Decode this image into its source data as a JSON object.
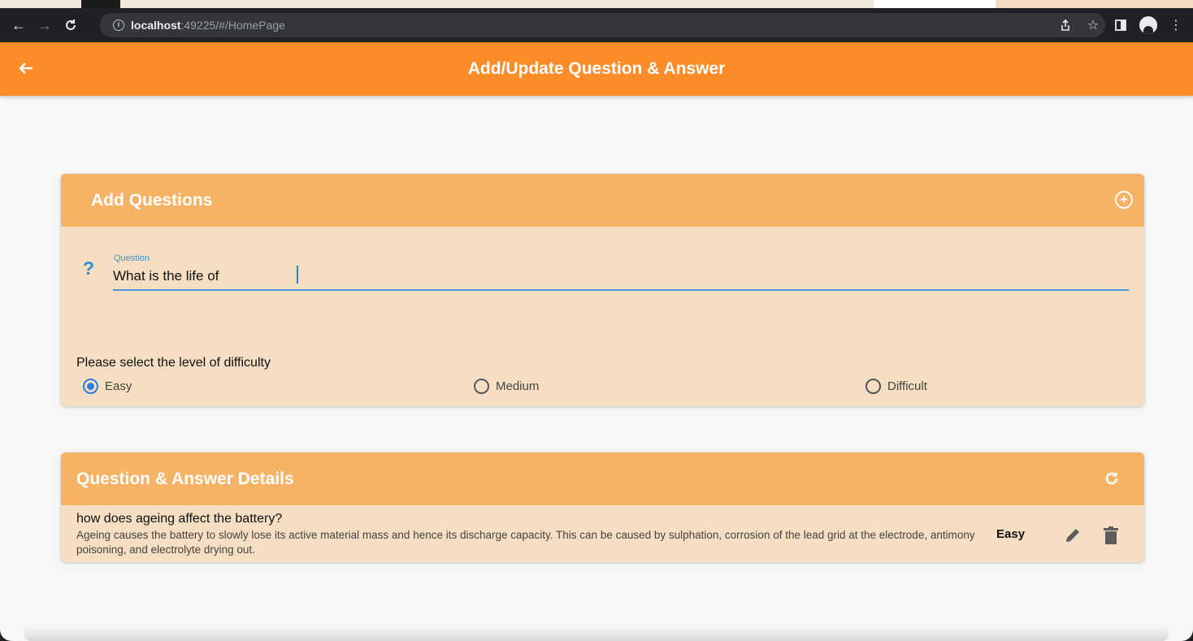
{
  "browser": {
    "host": "localhost",
    "path": ":49225/#/HomePage"
  },
  "app_bar": {
    "title": "Add/Update Question & Answer"
  },
  "add_card": {
    "header": "Add Questions",
    "question_label": "Question",
    "question_icon": "?",
    "question_value": "What is the life of ",
    "difficulty_prompt": "Please select the level of difficulty",
    "options": [
      {
        "label": "Easy",
        "selected": true
      },
      {
        "label": "Medium",
        "selected": false
      },
      {
        "label": "Difficult",
        "selected": false
      }
    ]
  },
  "details_card": {
    "header": "Question & Answer Details",
    "items": [
      {
        "question": "how does ageing affect the battery?",
        "answer": " Ageing causes the battery to slowly lose its active material mass and hence its discharge capacity. This can be caused by sulphation, corrosion of the lead grid at the electrode, antimony poisoning, and electrolyte drying out.",
        "level": "Easy"
      }
    ]
  },
  "colors": {
    "app_bar": "#fb8c28",
    "card_header": "#f6b265",
    "card_body": "#f5dec1",
    "accent_blue": "#2f7fe0"
  }
}
